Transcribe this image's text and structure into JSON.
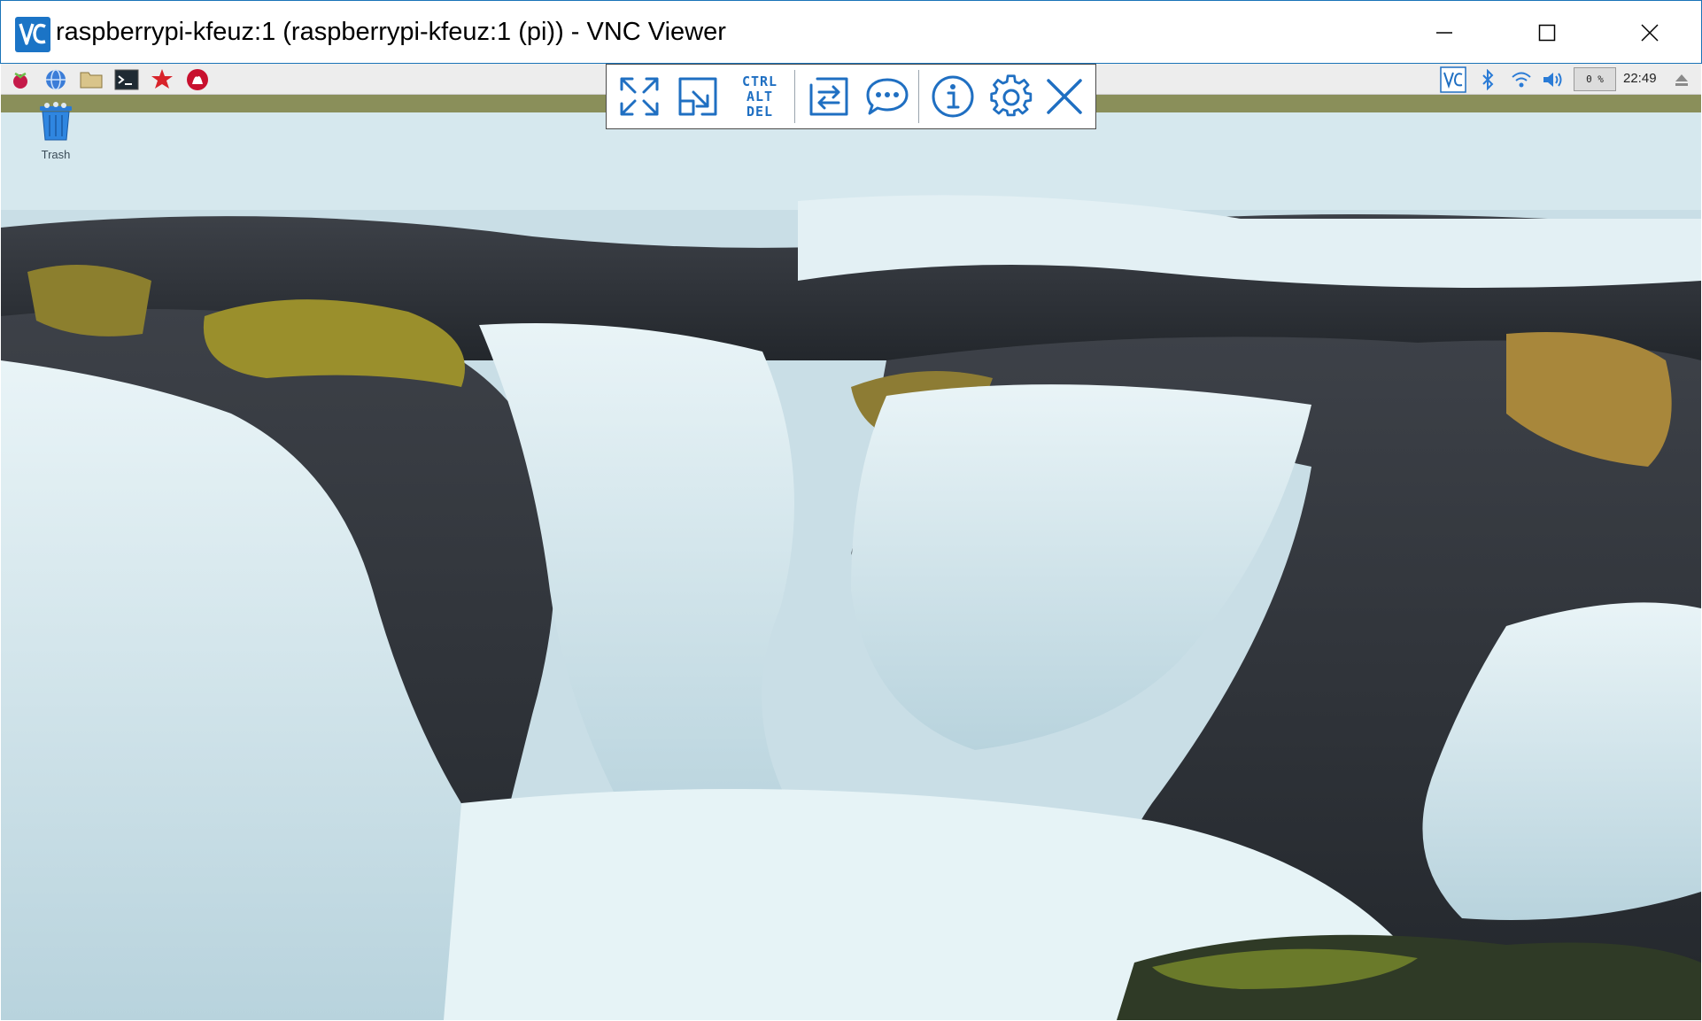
{
  "window": {
    "title": "raspberrypi-kfeuz:1 (raspberrypi-kfeuz:1 (pi)) - VNC Viewer",
    "app_icon": "vnc-viewer-logo",
    "controls": [
      "minimize-icon",
      "maximize-icon",
      "close-icon"
    ]
  },
  "panel": {
    "launchers": [
      "raspberry-menu-icon",
      "web-browser-icon",
      "file-manager-icon",
      "terminal-icon",
      "mathematica-icon",
      "wolfram-icon"
    ],
    "tray": [
      "vnc-server-icon",
      "bluetooth-icon",
      "wifi-icon",
      "volume-icon"
    ],
    "cpu_usage": "0 %",
    "clock": "22:49",
    "eject_icon": "eject-icon"
  },
  "desktop": {
    "icons": [
      {
        "label": "Trash",
        "icon": "trash-icon"
      }
    ]
  },
  "vnc_toolbar": {
    "cad_label": [
      "CTRL",
      "ALT",
      "DEL"
    ],
    "buttons": [
      "fullscreen-icon",
      "scale-icon",
      "ctrl-alt-del-button",
      "file-transfer-icon",
      "chat-icon",
      "info-icon",
      "settings-icon",
      "disconnect-icon"
    ]
  },
  "colors": {
    "accent": "#1f6fc2",
    "window_border": "#1a73b8",
    "panel": "#ededed"
  }
}
